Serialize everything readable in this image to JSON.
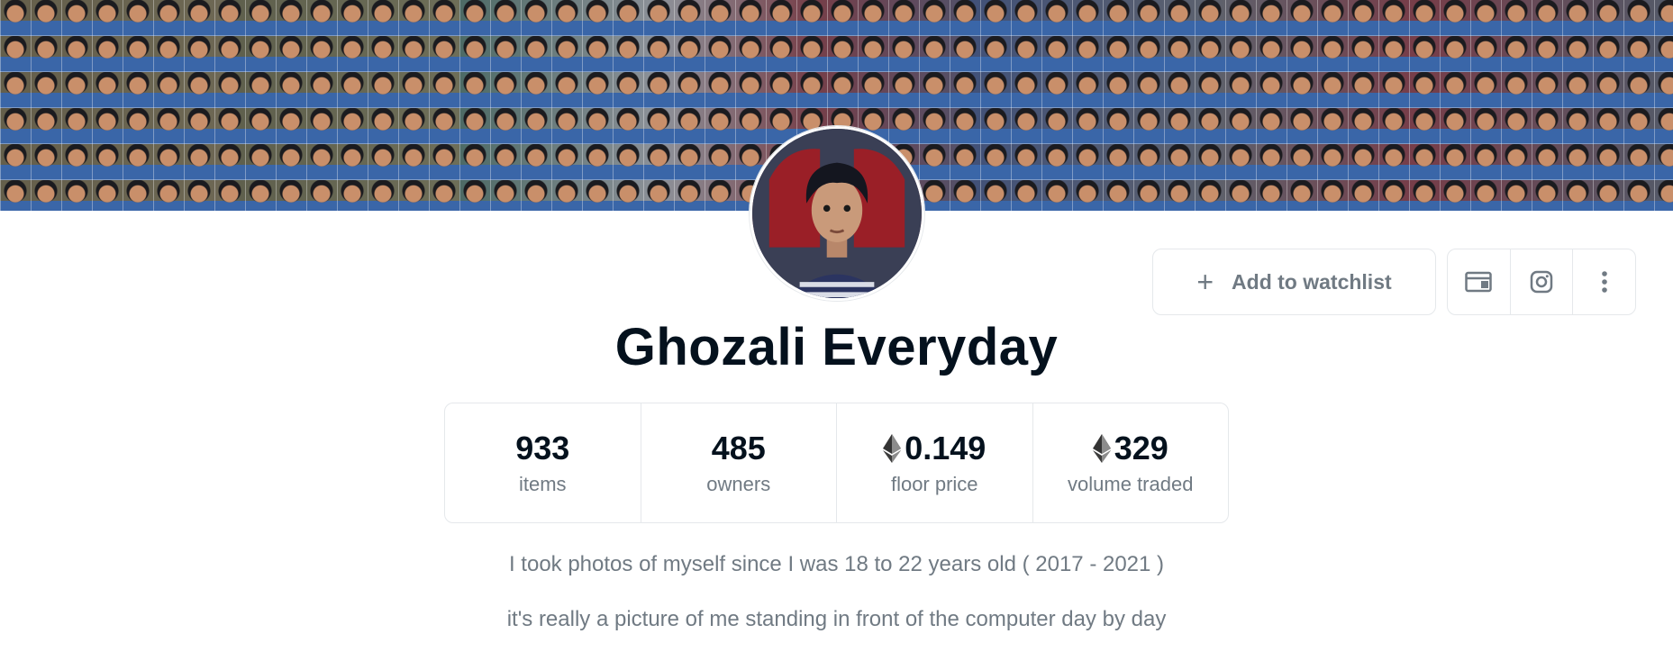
{
  "collection": {
    "name": "Ghozali Everyday",
    "description": [
      "I took photos of myself since I was 18 to 22 years old ( 2017 - 2021 )",
      "it's really a picture of me standing in front of the computer day by day"
    ]
  },
  "actions": {
    "watchlist_label": "Add to watchlist",
    "icons": [
      "website-icon",
      "instagram-icon",
      "more-options-icon"
    ]
  },
  "stats": [
    {
      "value": "933",
      "label": "items",
      "eth": false
    },
    {
      "value": "485",
      "label": "owners",
      "eth": false
    },
    {
      "value": "0.149",
      "label": "floor price",
      "eth": true
    },
    {
      "value": "329",
      "label": "volume traded",
      "eth": true
    }
  ],
  "colors": {
    "title": "#04111d",
    "muted": "#707a83",
    "border": "#e5e8eb"
  }
}
